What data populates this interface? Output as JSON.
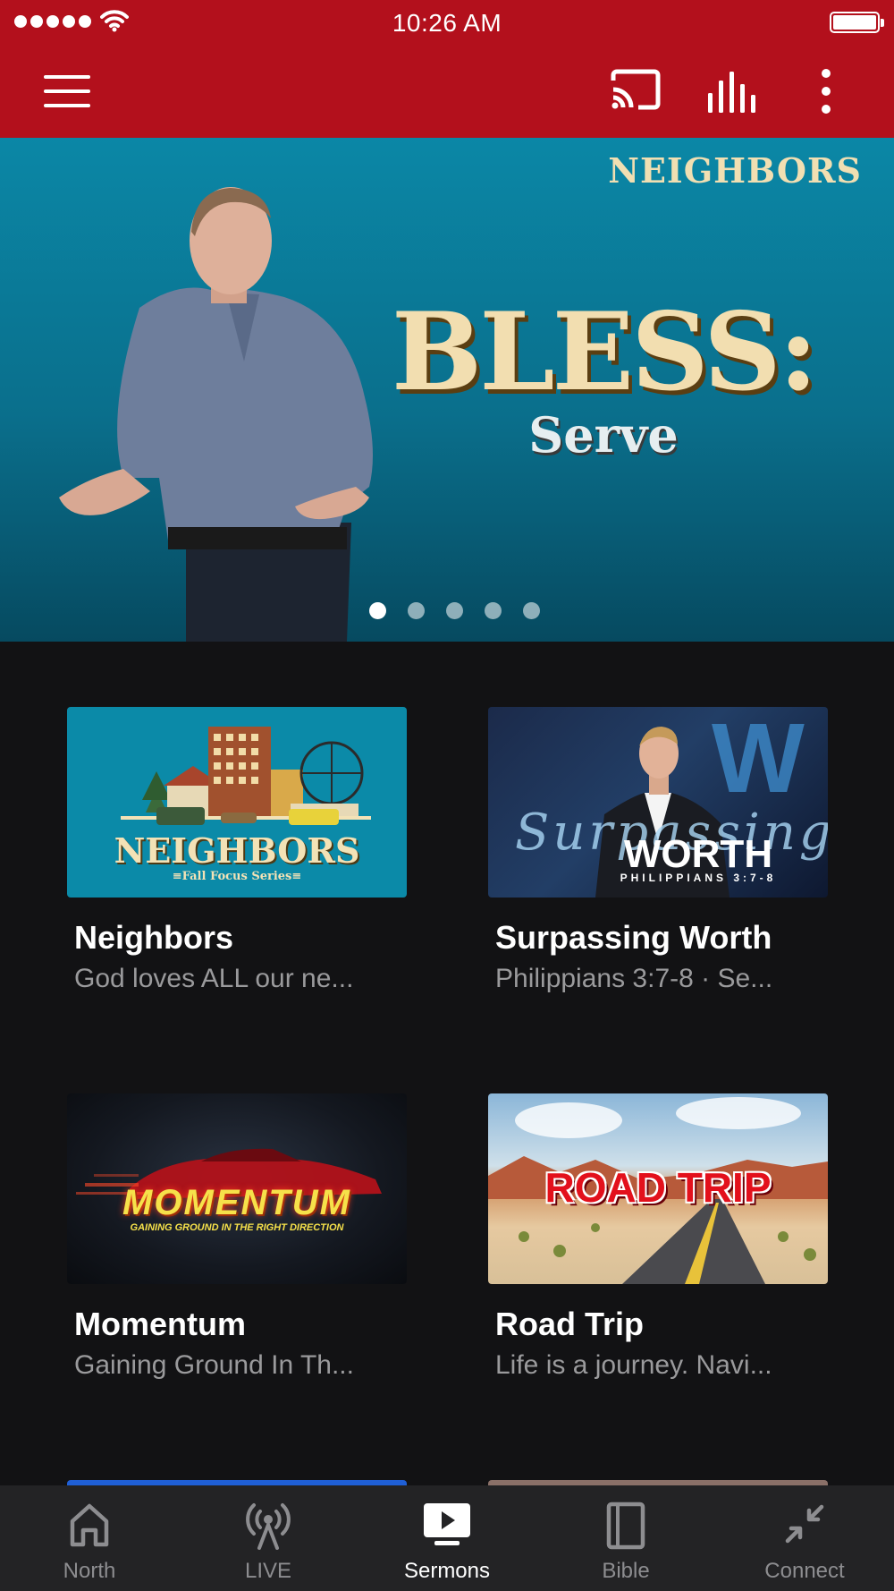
{
  "status_bar": {
    "time": "10:26 AM"
  },
  "hero": {
    "series": "NEIGHBORS",
    "title": "BLESS:",
    "subtitle": "Serve",
    "dots": 5,
    "active_dot": 0
  },
  "cards": [
    {
      "title": "Neighbors",
      "subtitle": "God loves ALL our ne...",
      "thumb_text": "NEIGHBORS",
      "thumb_tag": "≡Fall Focus Series≡"
    },
    {
      "title": "Surpassing Worth",
      "subtitle": "Philippians 3:7-8 · Se...",
      "thumb_text": "WORTH",
      "thumb_tag": "PHILIPPIANS 3:7-8",
      "thumb_script": "Surpassing"
    },
    {
      "title": "Momentum",
      "subtitle": "Gaining Ground In Th...",
      "thumb_text": "MOMENTUM",
      "thumb_tag": "GAINING GROUND IN THE RIGHT DIRECTION"
    },
    {
      "title": "Road Trip",
      "subtitle": "Life is a journey. Navi...",
      "thumb_text": "ROAD TRIP"
    }
  ],
  "tabs": [
    {
      "label": "North",
      "icon": "home-icon"
    },
    {
      "label": "LIVE",
      "icon": "broadcast-icon"
    },
    {
      "label": "Sermons",
      "icon": "play-screen-icon",
      "active": true
    },
    {
      "label": "Bible",
      "icon": "book-icon"
    },
    {
      "label": "Connect",
      "icon": "collapse-arrows-icon"
    }
  ],
  "colors": {
    "brand_red": "#b3101c",
    "background": "#121214",
    "tab_bar": "#232325",
    "hero_teal": "#0b87a6"
  }
}
